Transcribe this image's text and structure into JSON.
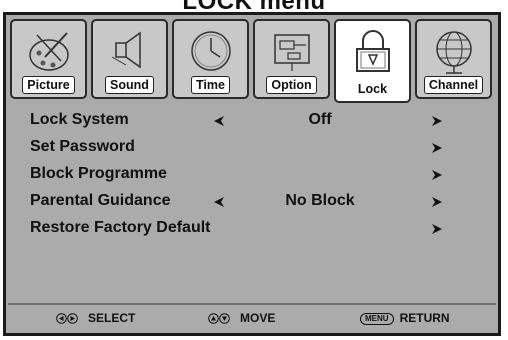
{
  "screen_title": "LOCK menu",
  "tabs": [
    {
      "label": "Picture",
      "icon": "picture-icon"
    },
    {
      "label": "Sound",
      "icon": "speaker-icon"
    },
    {
      "label": "Time",
      "icon": "clock-icon"
    },
    {
      "label": "Option",
      "icon": "option-icon"
    },
    {
      "label": "Lock",
      "icon": "padlock-icon",
      "active": true
    },
    {
      "label": "Channel",
      "icon": "globe-icon"
    }
  ],
  "menu_items": [
    {
      "label": "Lock System",
      "value": "Off"
    },
    {
      "label": "Set Password",
      "value": ""
    },
    {
      "label": "Block Programme",
      "value": ""
    },
    {
      "label": "Parental Guidance",
      "value": "No Block"
    },
    {
      "label": "Restore Factory Default",
      "value": ""
    }
  ],
  "footer": {
    "select_label": "SELECT",
    "move_label": "MOVE",
    "menu_key": "MENU",
    "return_label": "RETURN"
  },
  "colors": {
    "background": "#ababab",
    "tab_inactive": "#c8c8c8",
    "tab_active": "#ffffff",
    "frame": "#1a1a1a"
  }
}
